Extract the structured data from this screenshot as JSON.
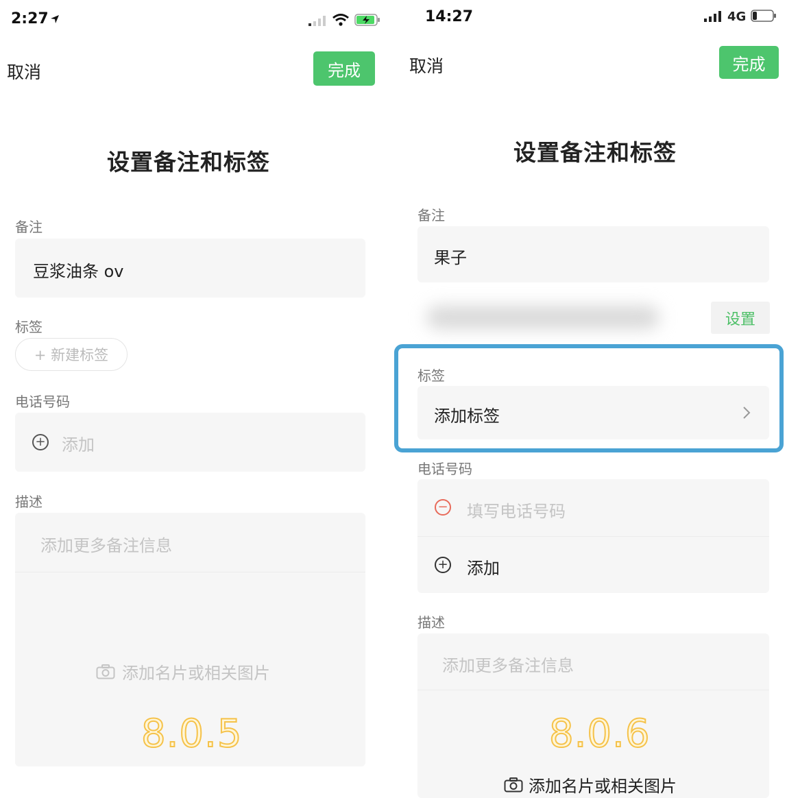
{
  "left": {
    "status": {
      "time": "2:27",
      "location_icon": "location-arrow-icon",
      "signal_icon": "signal-bars-icon",
      "wifi_icon": "wifi-icon",
      "battery_icon": "battery-charging-icon"
    },
    "nav": {
      "cancel_label": "取消",
      "done_label": "完成"
    },
    "title": "设置备注和标签",
    "remark": {
      "label": "备注",
      "value": "豆浆油条 ov"
    },
    "tags": {
      "label": "标签",
      "new_tag": "+ 新建标签"
    },
    "phone": {
      "label": "电话号码",
      "add_label": "添加",
      "add_icon": "plus-circle-icon"
    },
    "desc": {
      "label": "描述",
      "placeholder": "添加更多备注信息",
      "photo_label": "添加名片或相关图片",
      "photo_icon": "camera-icon"
    },
    "version": "8.0.5"
  },
  "right": {
    "status": {
      "time": "14:27",
      "signal_icon": "signal-bars-icon",
      "network": "4G",
      "battery_icon": "battery-low-icon"
    },
    "nav": {
      "cancel_label": "取消",
      "done_label": "完成"
    },
    "title": "设置备注和标签",
    "remark": {
      "label": "备注",
      "value": "果子"
    },
    "set_button": "设置",
    "tags": {
      "label": "标签",
      "add_label": "添加标签",
      "chevron_icon": "chevron-right-icon"
    },
    "phone": {
      "label": "电话号码",
      "placeholder": "填写电话号码",
      "remove_icon": "minus-circle-icon",
      "add_label": "添加",
      "add_icon": "plus-circle-icon"
    },
    "desc": {
      "label": "描述",
      "placeholder": "添加更多备注信息",
      "photo_label": "添加名片或相关图片",
      "photo_icon": "camera-icon"
    },
    "version": "8.0.6",
    "highlight_color": "#4aa3d4"
  },
  "colors": {
    "accent_green": "#4dc56d",
    "version_stroke": "#f5c24a",
    "remove_red": "#e86a5a"
  }
}
